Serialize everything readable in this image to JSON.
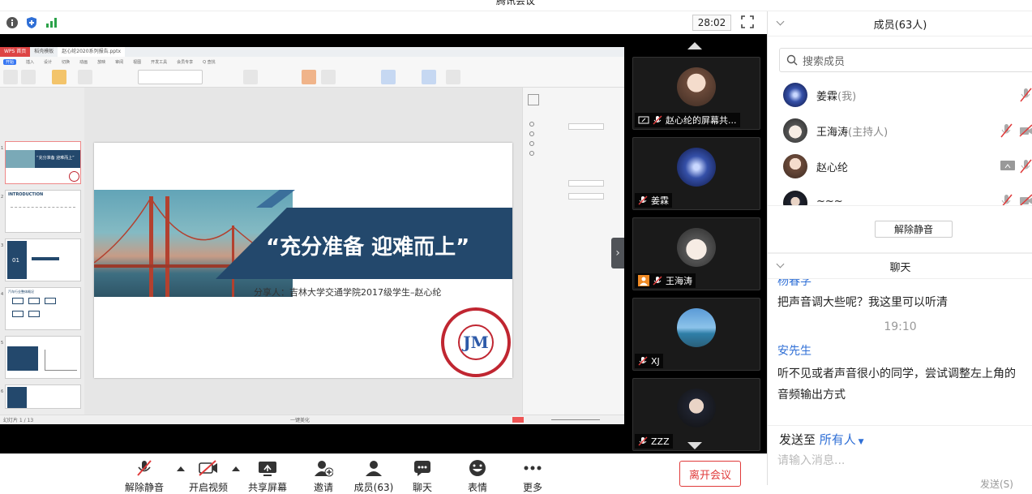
{
  "window": {
    "title": "腾讯会议"
  },
  "topbar": {
    "timer": "28:02"
  },
  "shared_screen": {
    "wps_tabs": [
      "WPS 首页",
      "稻壳模板",
      "赵心纶2020系列报告.pptx"
    ],
    "wps_menu": [
      "开始",
      "插入",
      "设计",
      "切换",
      "动画",
      "放映",
      "审阅",
      "视图",
      "开发工具",
      "会员专享",
      "Q 查找"
    ],
    "thumb_labels": [
      "“充分准备 迎难而上”",
      "INTRODUCTION",
      "01",
      "汽车行业整体概况"
    ],
    "slide_title": "“充分准备 迎难而上”",
    "slide_subtitle": "分享人：吉林大学交通学院2017级学生–赵心纶",
    "logo_text": "TRANSPORTATION COLLEGE OF JILIN UNIVERSITY",
    "logo_cn": "吉林大学交通学院",
    "status_left": "幻灯片 1 / 13",
    "status_zoom": "一键美化"
  },
  "video_strip": {
    "tiles": [
      {
        "name": "赵心纶的屏幕共..."
      },
      {
        "name": "姜霖"
      },
      {
        "name": "王海涛"
      },
      {
        "name": "XJ"
      },
      {
        "name": "ZZZ"
      }
    ]
  },
  "toolbar": {
    "buttons": [
      {
        "label": "解除静音"
      },
      {
        "label": "开启视频"
      },
      {
        "label": "共享屏幕"
      },
      {
        "label": "邀请"
      },
      {
        "label": "成员(63)"
      },
      {
        "label": "聊天"
      },
      {
        "label": "表情"
      },
      {
        "label": "更多"
      }
    ],
    "leave": "离开会议"
  },
  "members": {
    "header": "成员(63人)",
    "search_placeholder": "搜索成员",
    "list": [
      {
        "name": "姜霖",
        "role": "(我)"
      },
      {
        "name": "王海涛",
        "role": "(主持人)"
      },
      {
        "name": "赵心纶",
        "role": ""
      },
      {
        "name": "~~~",
        "role": ""
      }
    ],
    "unmute_all": "解除静音"
  },
  "chat": {
    "header": "聊天",
    "messages": [
      {
        "sender": "杨春学",
        "text": "把声音调大些呢？我这里可以听清"
      },
      {
        "time": "19:10"
      },
      {
        "sender": "安先生",
        "text": "听不见或者声音很小的同学，尝试调整左上角的",
        "text2": "音频输出方式"
      }
    ],
    "send_to_label": "发送至",
    "send_to_target": "所有人",
    "input_placeholder": "请输入消息...",
    "send_button": "发送(S)"
  },
  "colors": {
    "accent": "#2f6fd6",
    "leave": "#e03a3a",
    "slide_band": "#23486c",
    "logo": "#c02631"
  }
}
